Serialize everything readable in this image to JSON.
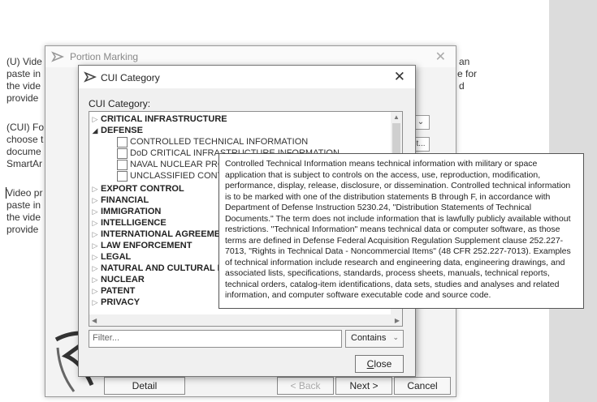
{
  "document": {
    "left_lines": [
      "(U) Vide",
      "paste in",
      "the vide",
      "provide",
      "",
      "(CUI) Fo",
      "choose t",
      "docume",
      "SmartAr",
      "",
      "Video pr",
      "paste in",
      "the vide",
      "provide"
    ],
    "right_fragments": [
      "an",
      "e for",
      "d"
    ]
  },
  "portion_marking": {
    "title": "Portion Marking",
    "side_buttons": [
      "⌄",
      "t..."
    ],
    "buttons": {
      "detail": "Detail",
      "back": "< Back",
      "next": "Next >",
      "cancel": "Cancel"
    }
  },
  "cui_dialog": {
    "title": "CUI Category",
    "label": "CUI Category:",
    "tree": [
      {
        "label": "CRITICAL INFRASTRUCTURE",
        "expanded": false
      },
      {
        "label": "DEFENSE",
        "expanded": true,
        "children": [
          "CONTROLLED TECHNICAL INFORMATION",
          "DoD CRITICAL INFRASTRUCTURE INFORMATION",
          "NAVAL NUCLEAR PROP",
          "UNCLASSIFIED CONTR"
        ]
      },
      {
        "label": "EXPORT CONTROL",
        "expanded": false
      },
      {
        "label": "FINANCIAL",
        "expanded": false
      },
      {
        "label": "IMMIGRATION",
        "expanded": false
      },
      {
        "label": "INTELLIGENCE",
        "expanded": false
      },
      {
        "label": "INTERNATIONAL AGREEME",
        "expanded": false
      },
      {
        "label": "LAW ENFORCEMENT",
        "expanded": false
      },
      {
        "label": "LEGAL",
        "expanded": false
      },
      {
        "label": "NATURAL AND CULTURAL R",
        "expanded": false
      },
      {
        "label": "NUCLEAR",
        "expanded": false
      },
      {
        "label": "PATENT",
        "expanded": false
      },
      {
        "label": "PRIVACY",
        "expanded": false
      }
    ],
    "filter_placeholder": "Filter...",
    "filter_mode": "Contains",
    "close_label": "Close"
  },
  "tooltip": {
    "text": "Controlled Technical Information means technical information with military or space application that is subject to controls on the access, use, reproduction, modification, performance, display, release, disclosure, or dissemination. Controlled technical information is to be marked with one of the distribution statements B through F, in accordance with Department of Defense Instruction 5230.24, \"Distribution Statements of Technical Documents.\" The term does not include information that is lawfully publicly available without restrictions. \"Technical Information\" means technical data or computer software, as those terms are defined in Defense Federal Acquisition Regulation Supplement clause 252.227-7013, \"Rights in Technical Data - Noncommercial Items\" (48 CFR 252.227-7013). Examples of technical information include research and engineering data, engineering drawings, and associated lists, specifications, standards, process sheets, manuals, technical reports, technical orders, catalog-item identifications, data sets, studies and analyses and related information, and computer software executable code and source code."
  },
  "icons": {
    "app_icon": "arrowhead-logo-icon",
    "close": "close-icon",
    "collapsed": "triangle-right-icon",
    "expanded": "triangle-down-icon",
    "dropdown": "chevron-down-icon"
  }
}
